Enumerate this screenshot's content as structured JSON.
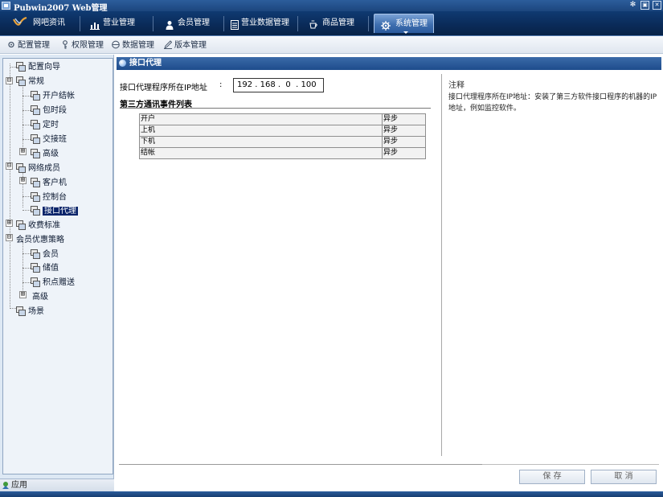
{
  "window": {
    "title": "Pubwin2007 Web管理"
  },
  "main_nav": {
    "tabs": [
      {
        "label": "网吧资讯",
        "icon": "brand-logo-icon"
      },
      {
        "label": "营业管理",
        "icon": "bar-chart-icon"
      },
      {
        "label": "会员管理",
        "icon": "user-icon"
      },
      {
        "label": "营业数据管理",
        "icon": "document-icon"
      },
      {
        "label": "商品管理",
        "icon": "coffee-cup-icon"
      },
      {
        "label": "系统管理",
        "icon": "gear-icon",
        "active": true
      }
    ]
  },
  "sub_nav": {
    "items": [
      {
        "label": "配置管理",
        "icon": "gear-icon"
      },
      {
        "label": "权限管理",
        "icon": "key-icon"
      },
      {
        "label": "数据管理",
        "icon": "database-icon"
      },
      {
        "label": "版本管理",
        "icon": "pencil-icon"
      }
    ]
  },
  "tree": {
    "nodes": [
      {
        "label": "配置向导"
      },
      {
        "label": "常规"
      },
      {
        "label": "开户结帐"
      },
      {
        "label": "包时段"
      },
      {
        "label": "定时"
      },
      {
        "label": "交接班"
      },
      {
        "label": "高级"
      },
      {
        "label": "网络成员"
      },
      {
        "label": "客户机"
      },
      {
        "label": "控制台"
      },
      {
        "label": "接口代理",
        "selected": true
      },
      {
        "label": "收费标准"
      },
      {
        "label": "会员优惠策略"
      },
      {
        "label": "会员"
      },
      {
        "label": "储值"
      },
      {
        "label": "积点赠送"
      },
      {
        "label": "高级"
      },
      {
        "label": "场景"
      }
    ],
    "toggles": [
      "⊟",
      "⊞",
      "⊟",
      "⊞",
      "⊞",
      "⊟",
      "⊞"
    ]
  },
  "sidebar_footer": {
    "label": "应用"
  },
  "panel": {
    "title": "接口代理",
    "ip_label": "接口代理程序所在IP地址",
    "ip_colon": ":",
    "ip_value": "192 . 168 .  0  . 100",
    "section_title": "第三方通讯事件列表",
    "events": [
      {
        "name": "开户",
        "mode": "异步"
      },
      {
        "name": "上机",
        "mode": "异步"
      },
      {
        "name": "下机",
        "mode": "异步"
      },
      {
        "name": "结帐",
        "mode": "异步"
      }
    ],
    "note_title": "注释",
    "note_body": "接口代理程序所在IP地址：安装了第三方软件接口程序的机器的IP地址，例如监控软件。"
  },
  "actions": {
    "save_label": "保 存",
    "cancel_label": "取 消"
  },
  "colors": {
    "nav_bg": "#0a2a57",
    "panel_header": "#1e4c8c",
    "tree_bg": "#eef3f9",
    "selection": "#0a246a"
  }
}
